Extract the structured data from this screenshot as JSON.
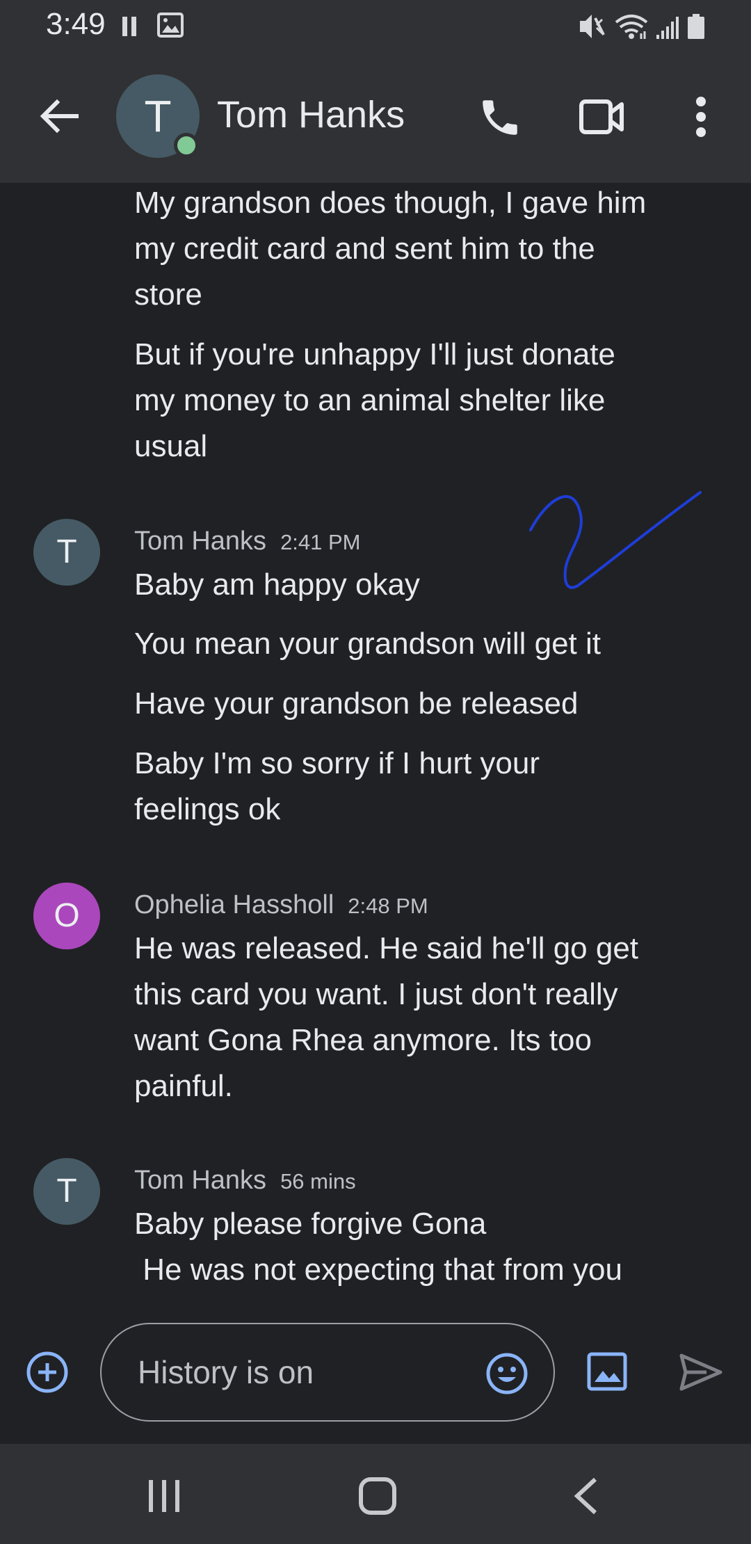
{
  "status_bar": {
    "time": "3:49"
  },
  "app_bar": {
    "avatar_letter": "T",
    "contact_name": "Tom Hanks"
  },
  "messages": [
    {
      "lines": "My grandson does though, I gave him\nmy credit card and sent him to the\nstore"
    },
    {
      "lines": "But if you're unhappy I'll just donate\nmy money to an animal shelter like\nusual"
    },
    {
      "sender": "Tom Hanks",
      "time": "2:41 PM",
      "avatar_letter": "T",
      "avatar_color": "#455a64"
    },
    {
      "lines": "Baby am happy okay"
    },
    {
      "lines": "You mean your grandson will get it"
    },
    {
      "lines": "Have your grandson be released"
    },
    {
      "lines": "Baby I'm so sorry if I hurt your\nfeelings ok"
    },
    {
      "sender": "Ophelia Hassholl",
      "time": "2:48 PM",
      "avatar_letter": "O",
      "avatar_color": "#ab47bc"
    },
    {
      "lines": "He was released. He said he'll go get\nthis card you want. I just don't really\nwant Gona Rhea anymore. Its too\npainful."
    },
    {
      "sender": "Tom Hanks",
      "time": "56 mins",
      "avatar_letter": "T",
      "avatar_color": "#455a64"
    },
    {
      "lines": "Baby please forgive Gona\n He was not expecting that from you"
    }
  ],
  "compose": {
    "placeholder": "History is on"
  },
  "colors": {
    "accent": "#8ab4f8",
    "online": "#81c995",
    "background": "#202124",
    "bar": "#303134"
  }
}
